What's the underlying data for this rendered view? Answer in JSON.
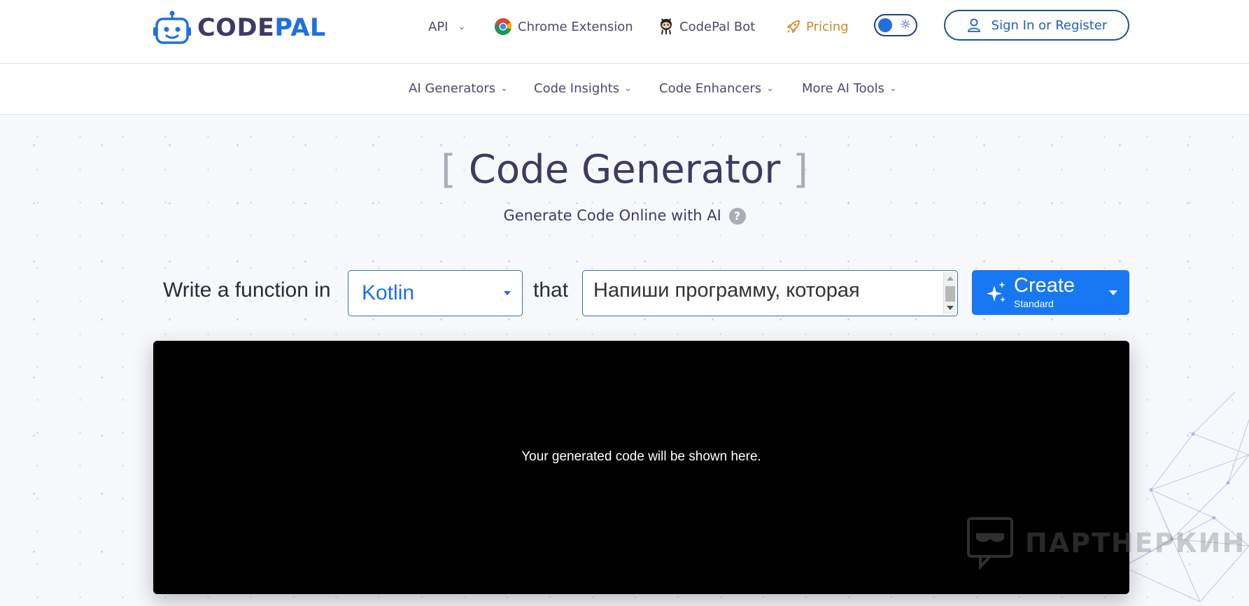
{
  "brand": {
    "logo_code": "CODE",
    "logo_pal": "PAL",
    "accent": "#1f6fe0",
    "primary_button": "#1877f2"
  },
  "topnav": {
    "api": "API",
    "chrome_extension": "Chrome Extension",
    "bot": "CodePal Bot",
    "pricing": "Pricing",
    "signin": "Sign In or Register"
  },
  "subnav": {
    "ai_generators": "AI Generators",
    "code_insights": "Code Insights",
    "code_enhancers": "Code Enhancers",
    "more_tools": "More AI Tools"
  },
  "hero": {
    "bracket_open": "[",
    "title": "Code Generator",
    "bracket_close": "]",
    "subtitle": "Generate Code Online with AI",
    "help": "?"
  },
  "form": {
    "prefix": "Write a function in",
    "language": "Kotlin",
    "connector": "that",
    "prompt": "Напиши программу, которая",
    "create_label": "Create",
    "create_mode": "Standard"
  },
  "output": {
    "placeholder": "Your generated code will be shown here."
  },
  "watermark": {
    "text": "ПАРТНЕРКИН"
  }
}
